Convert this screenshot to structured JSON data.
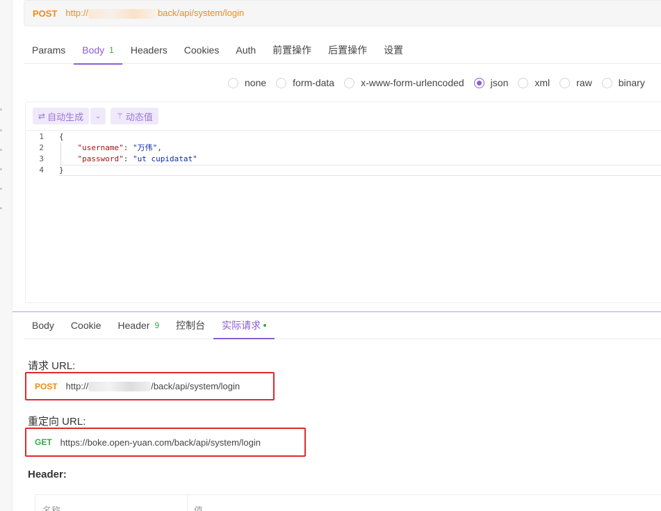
{
  "request": {
    "method": "POST",
    "url_prefix": "http://",
    "url_suffix": "back/api/system/login"
  },
  "request_tabs": [
    {
      "label": "Params"
    },
    {
      "label": "Body",
      "count": "1"
    },
    {
      "label": "Headers"
    },
    {
      "label": "Cookies"
    },
    {
      "label": "Auth"
    },
    {
      "label": "前置操作"
    },
    {
      "label": "后置操作"
    },
    {
      "label": "设置"
    }
  ],
  "body_types": [
    {
      "label": "none",
      "checked": false
    },
    {
      "label": "form-data",
      "checked": false
    },
    {
      "label": "x-www-form-urlencoded",
      "checked": false
    },
    {
      "label": "json",
      "checked": true
    },
    {
      "label": "xml",
      "checked": false
    },
    {
      "label": "raw",
      "checked": false
    },
    {
      "label": "binary",
      "checked": false
    }
  ],
  "editor": {
    "auto_generate": "自动生成",
    "dynamic_value": "动态值",
    "lines": [
      {
        "n": "1",
        "text": "{"
      },
      {
        "n": "2",
        "key": "\"username\"",
        "sep": ": ",
        "value": "\"万伟\"",
        "end": ","
      },
      {
        "n": "3",
        "key": "\"password\"",
        "sep": ": ",
        "value": "\"ut cupidatat\"",
        "end": ""
      },
      {
        "n": "4",
        "text": "}"
      }
    ]
  },
  "response_tabs": [
    {
      "label": "Body"
    },
    {
      "label": "Cookie"
    },
    {
      "label": "Header",
      "count": "9"
    },
    {
      "label": "控制台"
    },
    {
      "label": "实际请求"
    }
  ],
  "actual_request": {
    "request_url_label": "请求 URL:",
    "request_method": "POST",
    "request_url_prefix": "http://",
    "request_url_suffix": "/back/api/system/login",
    "redirect_url_label": "重定向 URL:",
    "redirect_method": "GET",
    "redirect_url": "https://boke.open-yuan.com/back/api/system/login",
    "header_title": "Header:",
    "table_columns": [
      "名称",
      "值"
    ]
  },
  "colors": {
    "accent": "#8a5cd6",
    "post": "#f08a1c",
    "get": "#39a548",
    "highlight_box": "#e0282a"
  },
  "icons": {
    "auto_generate": "sync-icon",
    "split_menu": "chevron-down-icon",
    "dynamic_value": "magic-wand-icon"
  }
}
